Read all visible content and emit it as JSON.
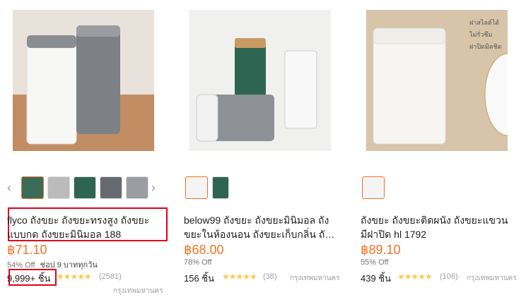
{
  "products": [
    {
      "title": "flyco ถังขยะ ถังขยะทรงสูง ถังขยะแบบกด ถังขยะมินิมอล 188",
      "price": "฿71.10",
      "discount": "54% Off",
      "shipping_note": "ช่อป 9 บาททุกวัน",
      "sold": "9,999+ ชิ้น",
      "reviews": "(2581)",
      "location": "กรุงเทพมหานคร",
      "stars": "★★★★★",
      "prev_arrow": "‹",
      "next_arrow": "›"
    },
    {
      "title": "below99 ถังขยะ ถังขยะมินิมอล ถังขยะในห้องนอน ถังขยะเก็บกลิ่น ถังขยะพลาสติ...",
      "price": "฿68.00",
      "discount": "78% Off",
      "sold": "156 ชิ้น",
      "reviews": "(38)",
      "location": "กรุงเทพมหานคร",
      "stars": "★★★★★"
    },
    {
      "title": "ถังขยะ ถังขยะติดผนัง ถังขยะแขวน มีฝาปิด hl 1792",
      "price": "฿89.10",
      "discount": "55% Off",
      "sold": "439 ชิ้น",
      "reviews": "(106)",
      "location": "กรุงเทพมหานคร",
      "stars": "★★★★★",
      "photo_text": [
        "ฝาสไลด์ได้",
        "ไม่รั่วซึม",
        "ฝาปิดมิดชิด"
      ]
    }
  ],
  "colors": {
    "price": "#f57224",
    "highlight": "#e3001b",
    "stars": "#faca51"
  }
}
